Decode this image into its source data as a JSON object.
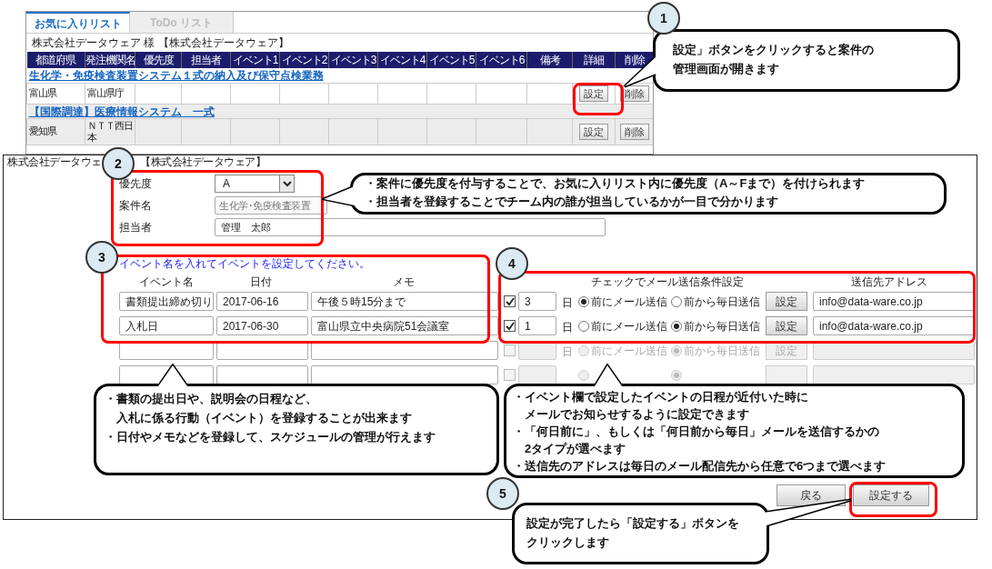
{
  "favorites_panel": {
    "tabs": [
      {
        "label": "お気に入りリスト",
        "selected": true
      },
      {
        "label": "ToDo リスト",
        "selected": false
      }
    ],
    "account": "株式会社データウェア 様 【株式会社データウェア】",
    "columns": [
      "都道府県",
      "発注機関名",
      "優先度",
      "担当者",
      "イベント1",
      "イベント2",
      "イベント3",
      "イベント4",
      "イベント5",
      "イベント6",
      "備考",
      "詳細",
      "削除"
    ],
    "projects": [
      {
        "title": "生化学・免疫検査装置システム１式の納入及び保守点検業務",
        "shaded": false,
        "cells": [
          [
            "富山県"
          ],
          [
            "富山県庁"
          ]
        ],
        "buttons": [
          "設定",
          "削除"
        ]
      },
      {
        "title": "【国際調達】医療情報システム　一式",
        "shaded": true,
        "cells": [
          [
            "愛知県"
          ],
          [
            "ＮＴＴ西日",
            "本"
          ]
        ],
        "buttons": [
          "設定",
          "削除"
        ]
      }
    ]
  },
  "settings_panel": {
    "account_parts": [
      "株式会社データウェ",
      "【株式会社データウェア】"
    ],
    "fields": [
      {
        "label": "優先度",
        "kind": "select",
        "value": "A"
      },
      {
        "label": "案件名",
        "kind": "text",
        "value": "生化学･免疫検査装置",
        "dim": true
      },
      {
        "label": "担当者",
        "kind": "text",
        "value": "管理　太郎",
        "dim": false
      }
    ],
    "event_instruction": "イベント名を入れてイベントを設定してください。",
    "event_columns": [
      "イベント名",
      "日付",
      "メモ"
    ],
    "mail_columns": [
      "チェックでメール送信条件設定",
      "送信先アドレス"
    ],
    "events": [
      {
        "name": "書類提出締め切り",
        "date": "2017-06-16",
        "memo": "午後５時15分まで",
        "checked": true,
        "days": "3",
        "unit": "日",
        "options": [
          {
            "label": "前にメール送信",
            "selected": true
          },
          {
            "label": "前から毎日送信",
            "selected": false
          }
        ],
        "button": "設定",
        "address": "info@data-ware.co.jp",
        "disabled": false
      },
      {
        "name": "入札日",
        "date": "2017-06-30",
        "memo": "富山県立中央病院51会議室",
        "checked": true,
        "days": "1",
        "unit": "日",
        "options": [
          {
            "label": "前にメール送信",
            "selected": false
          },
          {
            "label": "前から毎日送信",
            "selected": true
          }
        ],
        "button": "設定",
        "address": "info@data-ware.co.jp",
        "disabled": false
      },
      {
        "checked": false,
        "unit": "日",
        "options": [
          {
            "label": "前にメール送信",
            "selected": false
          },
          {
            "label": "前から毎日送信",
            "selected": true
          }
        ],
        "button": "設定",
        "disabled": true
      },
      {
        "checked": false,
        "options": [
          {
            "selected": false
          },
          {
            "selected": true
          }
        ],
        "disabled": true
      }
    ],
    "buttons": [
      "戻る",
      "設定する"
    ]
  },
  "callouts": [
    {
      "number": "1",
      "lines": [
        "設定」ボタンをクリックすると案件の",
        "管理画面が開きます"
      ]
    },
    {
      "number": "2",
      "lines": [
        "・案件に優先度を付与することで、お気に入りリスト内に優先度（A～Fまで）を付けられます",
        "・担当者を登録することでチーム内の誰が担当しているかが一目で分かります"
      ]
    },
    {
      "number": "3",
      "lines": [
        "・書類の提出日や、説明会の日程など、",
        "　入札に係る行動（イベント）を登録することが出来ます",
        "・日付やメモなどを登録して、スケジュールの管理が行えます"
      ]
    },
    {
      "number": "4",
      "lines": [
        "・イベント欄で設定したイベントの日程が近付いた時に",
        "　メールでお知らせするように設定できます",
        "・「何日前に」、もしくは「何日前から毎日」メールを送信するかの",
        "　2タイプが選べます",
        "・送信先のアドレスは毎日のメール配信先から任意で6つまで選べます"
      ]
    },
    {
      "number": "5",
      "lines": [
        "設定が完了したら「設定する」ボタンを",
        "クリックします"
      ]
    }
  ]
}
